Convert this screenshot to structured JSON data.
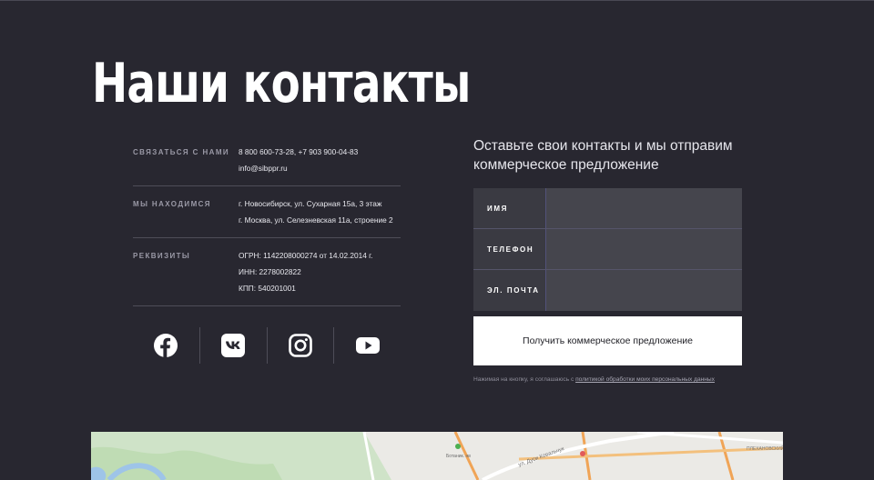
{
  "page": {
    "title": "Наши контакты"
  },
  "contacts": {
    "rows": [
      {
        "label": "СВЯЗАТЬСЯ С НАМИ",
        "values": [
          "8 800 600-73-28, +7 903 900-04-83",
          "info@sibppr.ru"
        ]
      },
      {
        "label": "МЫ НАХОДИМСЯ",
        "values": [
          "г. Новосибирск, ул. Сухарная 15а, 3 этаж",
          "г. Москва, ул. Селезневская 11а, строение 2"
        ]
      },
      {
        "label": "РЕКВИЗИТЫ",
        "values": [
          "ОГРН: 1142208000274 от 14.02.2014 г.",
          "ИНН: 2278002822",
          "КПП: 540201001"
        ]
      }
    ]
  },
  "social": {
    "icons": [
      "facebook-icon",
      "vk-icon",
      "instagram-icon",
      "youtube-icon"
    ]
  },
  "form": {
    "heading": "Оставьте свои контакты и мы отправим коммерческое предложение",
    "fields": [
      {
        "label": "ИМЯ",
        "value": ""
      },
      {
        "label": "ТЕЛЕФОН",
        "value": ""
      },
      {
        "label": "ЭЛ. ПОЧТА",
        "value": ""
      }
    ],
    "submit_label": "Получить коммерческое предложение",
    "consent_text": "Нажимая на кнопку, я соглашаюсь с ",
    "consent_link": "политикой обработки моих персональных данных"
  },
  "map": {
    "labels": {
      "street": "ул. Дуси Ковальчук",
      "area": "ПЛЕХАНОВСКИЙ",
      "place": "Ботаник. нв"
    }
  },
  "colors": {
    "background": "#282730",
    "field_label_bg": "#3a3a42",
    "field_input_bg": "#45454d",
    "button_bg": "#ffffff"
  }
}
